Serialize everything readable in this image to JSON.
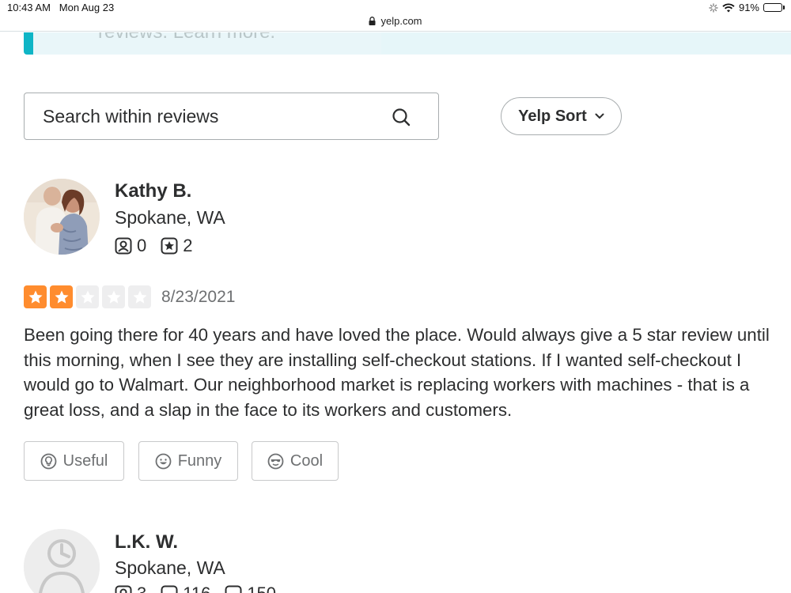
{
  "status_bar": {
    "time": "10:43 AM",
    "date": "Mon Aug 23",
    "url": "yelp.com",
    "battery": "91%",
    "battery_level": 0.91
  },
  "banner": {
    "text": "reviews. Learn more."
  },
  "search": {
    "placeholder": "Search within reviews"
  },
  "sort": {
    "label": "Yelp Sort"
  },
  "reviews": [
    {
      "user": {
        "name": "Kathy B.",
        "location": "Spokane, WA",
        "friends": "0",
        "reviews": "2"
      },
      "rating": 2,
      "max_rating": 5,
      "date": "8/23/2021",
      "text": "Been going there for 40 years and have loved the place. Would always give a 5 star review until this morning, when I see they are installing self-checkout stations.  If I wanted self-checkout I would go to Walmart. Our neighborhood market is replacing workers with machines - that is a great loss, and a slap in  the face to its workers and customers.",
      "reactions": {
        "useful": "Useful",
        "funny": "Funny",
        "cool": "Cool"
      }
    },
    {
      "user": {
        "name": "L.K. W.",
        "location": "Spokane, WA",
        "friends": "3",
        "reviews": "116",
        "photos": "150"
      }
    }
  ],
  "colors": {
    "star_on": "#ff8c2e",
    "star_off": "#eeeeef",
    "banner_accent": "#0fb5c6"
  }
}
